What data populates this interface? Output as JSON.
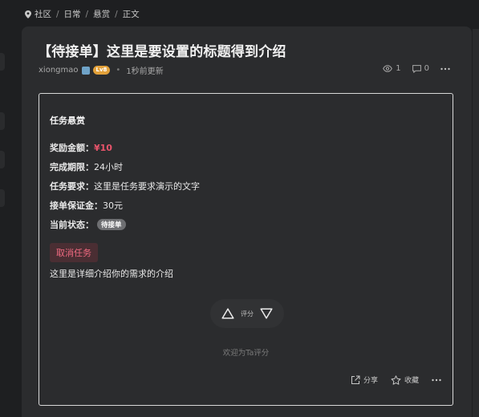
{
  "breadcrumb": {
    "items": [
      "社区",
      "日常",
      "悬赏",
      "正文"
    ]
  },
  "post": {
    "title": "【待接单】这里是要设置的标题得到介绍",
    "author": "xiongmao",
    "level": "Lv8",
    "time": "1秒前更新",
    "views": "1",
    "comments": "0"
  },
  "task": {
    "heading": "任务悬赏",
    "reward_label": "奖励金额：",
    "reward_value": "¥10",
    "deadline_label": "完成期限：",
    "deadline_value": "24小时",
    "requirement_label": "任务要求：",
    "requirement_value": "这里是任务要求演示的文字",
    "deposit_label": "接单保证金：",
    "deposit_value": "30元",
    "status_label": "当前状态：",
    "status_value": "待接单",
    "cancel_label": "取消任务",
    "description": "这里是详细介绍你的需求的介绍"
  },
  "vote": {
    "label": "评分",
    "thanks": "欢迎为Ta评分"
  },
  "actions": {
    "share": "分享",
    "favorite": "收藏"
  },
  "colors": {
    "accent": "#e9546b",
    "background": "#1e1f21",
    "card": "#2b2c2e"
  }
}
